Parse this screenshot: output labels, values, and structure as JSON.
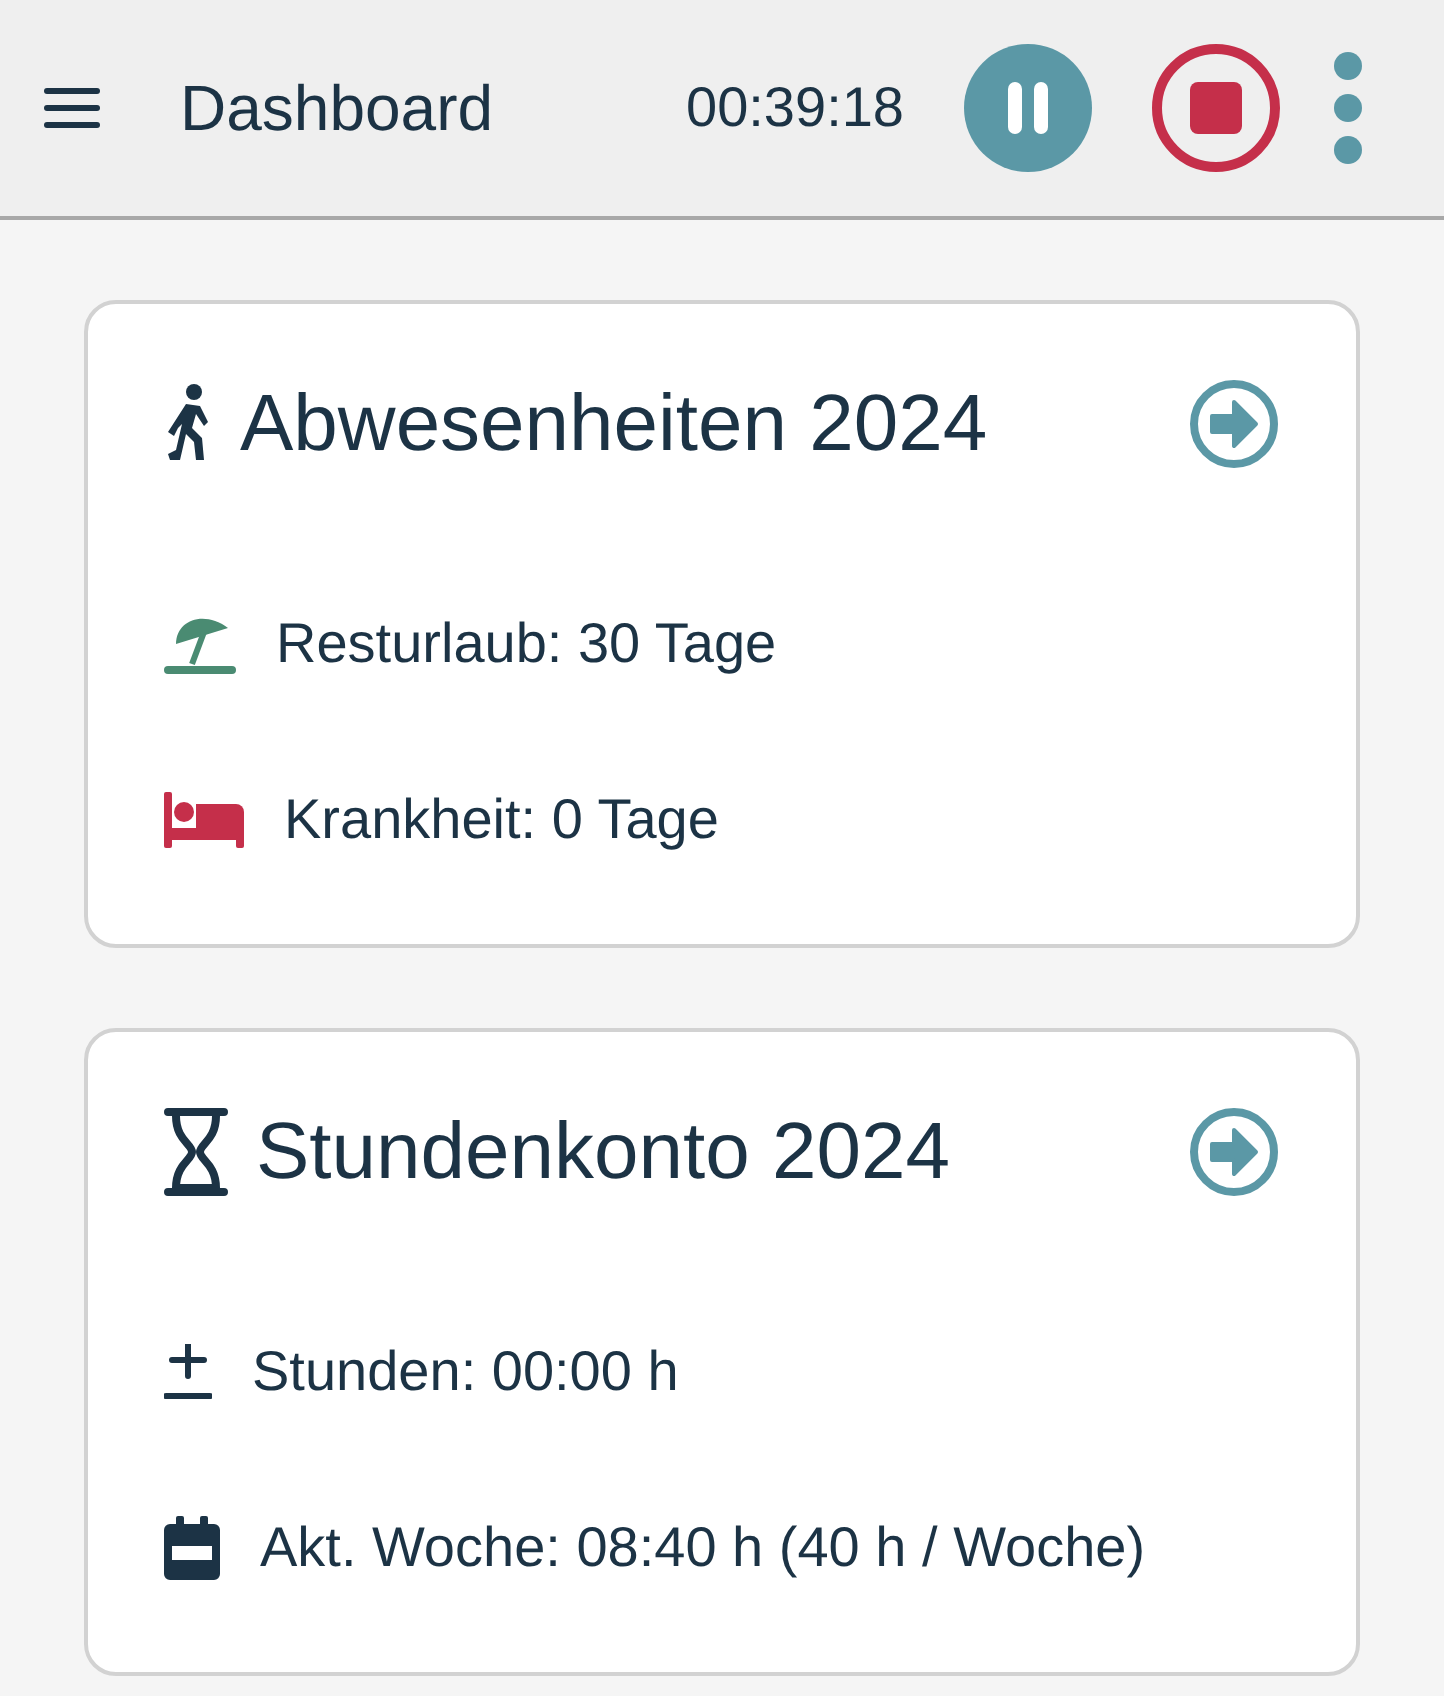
{
  "header": {
    "title": "Dashboard",
    "timer": "00:39:18"
  },
  "cards": [
    {
      "title": "Abwesenheiten 2024",
      "kind": "walk",
      "items": [
        {
          "kind": "umbrella",
          "color": "#4a8b72",
          "text": "Resturlaub: 30 Tage"
        },
        {
          "kind": "bed",
          "color": "#c52f4a",
          "text": "Krankheit: 0 Tage"
        }
      ]
    },
    {
      "title": "Stundenkonto 2024",
      "kind": "hourglass",
      "items": [
        {
          "kind": "plusminus",
          "color": "#1c3345",
          "text": "Stunden: 00:00 h"
        },
        {
          "kind": "calendar",
          "color": "#1c3345",
          "text": "Akt. Woche: 08:40 h (40 h / Woche)"
        }
      ]
    }
  ]
}
